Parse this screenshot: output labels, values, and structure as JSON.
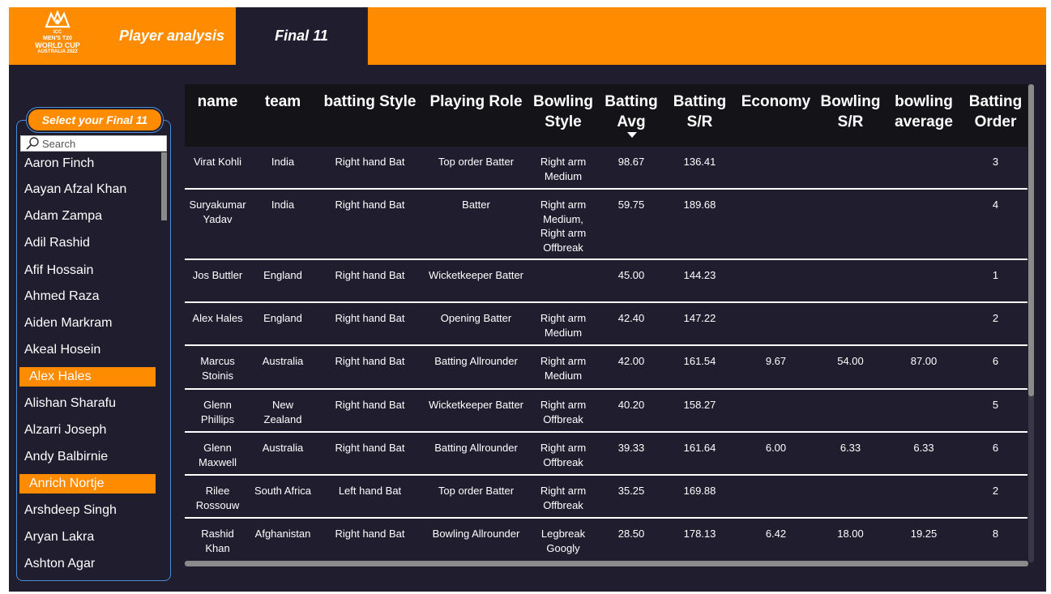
{
  "header": {
    "logo": {
      "line1": "ICC",
      "line2": "MEN'S T20",
      "line3": "WORLD CUP",
      "line4": "AUSTRALIA 2022"
    },
    "tabs": [
      {
        "label": "Player analysis",
        "active": false
      },
      {
        "label": "Final 11",
        "active": true
      }
    ],
    "accent_color": "#ff8c00"
  },
  "slicer": {
    "title": "Select your Final 11",
    "search_placeholder": "Search",
    "items": [
      {
        "label": "Aaron Finch",
        "selected": false
      },
      {
        "label": "Aayan Afzal Khan",
        "selected": false
      },
      {
        "label": "Adam Zampa",
        "selected": false
      },
      {
        "label": "Adil Rashid",
        "selected": false
      },
      {
        "label": "Afif Hossain",
        "selected": false
      },
      {
        "label": "Ahmed Raza",
        "selected": false
      },
      {
        "label": "Aiden Markram",
        "selected": false
      },
      {
        "label": "Akeal Hosein",
        "selected": false
      },
      {
        "label": "Alex Hales",
        "selected": true
      },
      {
        "label": "Alishan Sharafu",
        "selected": false
      },
      {
        "label": "Alzarri Joseph",
        "selected": false
      },
      {
        "label": "Andy Balbirnie",
        "selected": false
      },
      {
        "label": "Anrich Nortje",
        "selected": true
      },
      {
        "label": "Arshdeep Singh",
        "selected": false
      },
      {
        "label": "Aryan Lakra",
        "selected": false
      },
      {
        "label": "Ashton Agar",
        "selected": false
      }
    ]
  },
  "table": {
    "columns": [
      {
        "label": "name"
      },
      {
        "label": "team"
      },
      {
        "label": "batting Style"
      },
      {
        "label": "Playing Role"
      },
      {
        "label": "Bowling Style"
      },
      {
        "label": "Batting Avg",
        "sorted": "desc"
      },
      {
        "label": "Batting S/R"
      },
      {
        "label": "Economy"
      },
      {
        "label": "Bowling S/R"
      },
      {
        "label": "bowling average"
      },
      {
        "label": "Batting Order"
      }
    ],
    "rows": [
      {
        "cells": [
          "Virat Kohli",
          "India",
          "Right hand Bat",
          "Top order Batter",
          "Right arm Medium",
          "98.67",
          "136.41",
          "",
          "",
          "",
          "3"
        ]
      },
      {
        "cells": [
          "Suryakumar Yadav",
          "India",
          "Right hand Bat",
          "Batter",
          "Right arm Medium, Right arm Offbreak",
          "59.75",
          "189.68",
          "",
          "",
          "",
          "4"
        ]
      },
      {
        "cells": [
          "Jos Buttler",
          "England",
          "Right hand Bat",
          "Wicketkeeper Batter",
          "",
          "45.00",
          "144.23",
          "",
          "",
          "",
          "1"
        ]
      },
      {
        "cells": [
          "Alex Hales",
          "England",
          "Right hand Bat",
          "Opening Batter",
          "Right arm Medium",
          "42.40",
          "147.22",
          "",
          "",
          "",
          "2"
        ]
      },
      {
        "cells": [
          "Marcus Stoinis",
          "Australia",
          "Right hand Bat",
          "Batting Allrounder",
          "Right arm Medium",
          "42.00",
          "161.54",
          "9.67",
          "54.00",
          "87.00",
          "6"
        ]
      },
      {
        "cells": [
          "Glenn Phillips",
          "New Zealand",
          "Right hand Bat",
          "Wicketkeeper Batter",
          "Right arm Offbreak",
          "40.20",
          "158.27",
          "",
          "",
          "",
          "5"
        ]
      },
      {
        "cells": [
          "Glenn Maxwell",
          "Australia",
          "Right hand Bat",
          "Batting Allrounder",
          "Right arm Offbreak",
          "39.33",
          "161.64",
          "6.00",
          "6.33",
          "6.33",
          "6"
        ]
      },
      {
        "cells": [
          "Rilee Rossouw",
          "South Africa",
          "Left hand Bat",
          "Top order Batter",
          "Right arm Offbreak",
          "35.25",
          "169.88",
          "",
          "",
          "",
          "2"
        ]
      },
      {
        "cells": [
          "Rashid Khan",
          "Afghanistan",
          "Right hand Bat",
          "Bowling Allrounder",
          "Legbreak Googly",
          "28.50",
          "178.13",
          "6.42",
          "18.00",
          "19.25",
          "8"
        ]
      }
    ]
  }
}
